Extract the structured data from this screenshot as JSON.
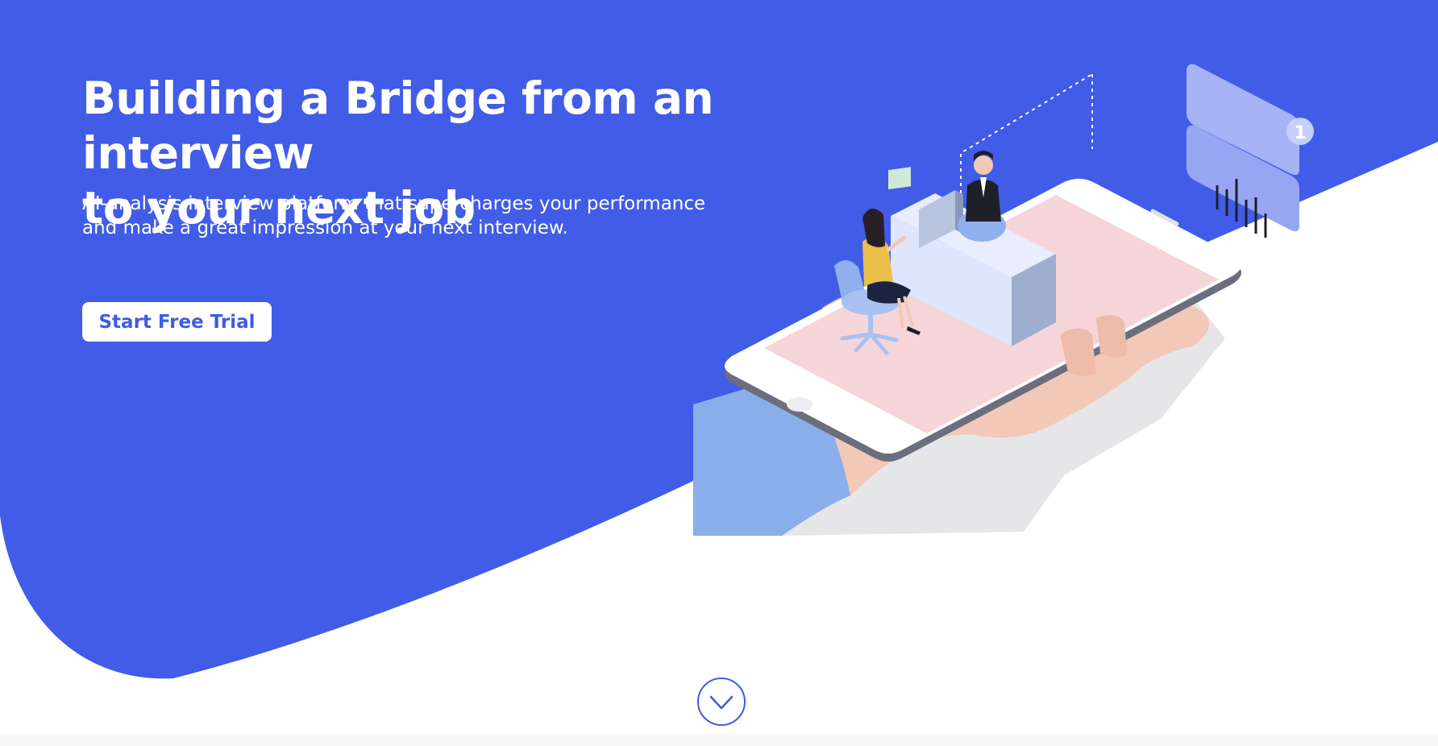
{
  "hero": {
    "headline_line1": "Building a Bridge from an interview",
    "headline_line2": "to your next job",
    "subtitle_line1": "AI-analysis interview platform that supercharges your performance",
    "subtitle_line2": "and make a great impression at your next interview.",
    "cta_label": "Start Free Trial"
  },
  "illustration": {
    "notification_count": "1"
  },
  "icons": {
    "scroll_down": "chevron-down-icon"
  },
  "colors": {
    "brand_blue": "#415ce6",
    "button_text": "#3f5be5",
    "white": "#ffffff",
    "sleeve": "#8aaeea",
    "skin": "#f2c8b8",
    "screen_pink": "#f6d5d8"
  }
}
